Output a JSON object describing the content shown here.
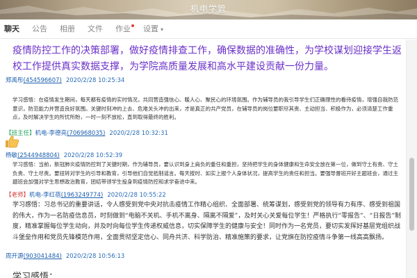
{
  "window": {
    "title": "机电学管"
  },
  "tabs": [
    {
      "label": "聊天",
      "active": true
    },
    {
      "label": "公告"
    },
    {
      "label": "相册"
    },
    {
      "label": "文件"
    },
    {
      "label": "作业",
      "badge": true
    },
    {
      "label": "设置",
      "dropdown": true
    }
  ],
  "messages": {
    "m1": {
      "text": "疫情防控工作的决策部署，做好疫情排查工作，确保数据的准确性，为学校谋划迎接学生返校工作提供真实数据支撑，为学院高质量发展和高水平建设贡献一份力量。",
      "color": "#6b31c8"
    },
    "s2": {
      "name": "郑禹彤",
      "qq": "(454596607)",
      "time": "2020/2/28 10:25:34"
    },
    "m2": {
      "text": "学习感悟：在疫情发生期间，每天都有疫情的实时情况，共同营造强信心、暖人心、聚民心的环境氛围。作为辅导员的我引导学生们正确理性的看待疫情，增强自我防范意识，防范能力并营造良好氛围。关键时刻冲的上去、危难关头冲的出来，才是真正的共产党员，在辅导员的岗位要职尽其责、主动担当、积极作为，必须清楚工作重点，及时解决学生的所忧所盼，一时一刻不放松，直到取得最终的胜利。"
    },
    "s3": {
      "tag": "【班主任】",
      "name": "机电-李德亮",
      "qq": "(706968035)",
      "time": "2020/2/28 10:32:31"
    },
    "s4": {
      "name": "杨敏",
      "qq": "(2544948804)",
      "time": "2020/2/28 10:52:39"
    },
    "m4": {
      "text": "学习感悟：当前，新冠肺炎疫情防控到了关键时期，作为辅导员，要认识到身上肩负的重任和重担，坚持把学生的身体健康和生命安全放在第一位，做到守土有责、守土负责、守土尽责。要扭转对学生的引导和教育，引导他们自觉抵制谣言。每天按时、如实上报个人身体状况，提高学生的责任和担当。要强导督班开好主题班会，通过主题班会加强对学生思想政治教育，团结带领学生投身到疫情防控和求学奋进中来。"
    },
    "s5": {
      "tag": "【老师】",
      "name": "机电-李红蓓",
      "qq": "(1963249774)",
      "time": "2020/2/28 10:55:22"
    },
    "m5": {
      "text": "学习感悟：习总书记的重要讲话，令人感受到党中央对抗击疫情工作精心组织、全面部署、统筹谋划，感受到党的领导有力有序、感受到祖国的伟大，作为一名防疫信息员，时刻做到“电脑不关机、手机不离身、隔离不隔爱”，及时关心关爱每位学生！严格执行“零报告”、“日报告”制度，精准掌握每位学生动向，并及时向每位学生传递权威信息，切实保障学生的健康与安全！同时作为一名党员，要切实发挥好基层党组织战斗堡垒作用和党员先锋模范作用，全面贯彻坚定信心、同舟共济、科学防治、精准施策的要求，让党旗在防控疫情斗争第一线高高飘扬。"
    },
    "s6": {
      "name": "周开源",
      "qq": "(903041484)",
      "time": "2020/2/28 10:56:13"
    },
    "m6": {
      "text": "学习感悟："
    }
  }
}
